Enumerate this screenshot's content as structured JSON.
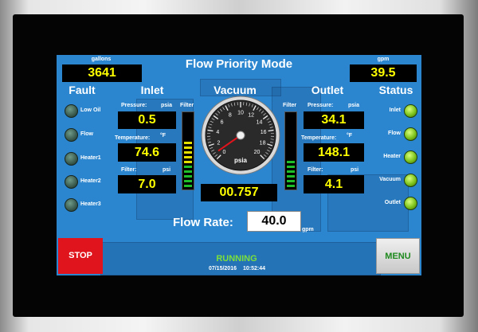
{
  "screen": {
    "title": "Flow Priority Mode",
    "left_counter": {
      "unit": "gallons",
      "value": "3641"
    },
    "right_counter": {
      "unit": "gpm",
      "value": "39.5"
    }
  },
  "fault": {
    "title": "Fault",
    "items": [
      {
        "label": "Low Oil",
        "state": "off"
      },
      {
        "label": "Flow",
        "state": "off"
      },
      {
        "label": "Heater1",
        "state": "off"
      },
      {
        "label": "Heater2",
        "state": "off"
      },
      {
        "label": "Heater3",
        "state": "off"
      }
    ]
  },
  "inlet": {
    "title": "Inlet",
    "pressure_label": "Pressure:",
    "pressure_unit": "psia",
    "pressure": "0.5",
    "temperature_label": "Temperature:",
    "temperature_unit": "°F",
    "temperature": "74.6",
    "filter_label": "Filter:",
    "filter_unit": "psi",
    "filter": "7.0",
    "bar_label": "Filter"
  },
  "vacuum": {
    "title": "Vacuum",
    "value": "00.757",
    "gauge_unit": "psia",
    "gauge_min": 0,
    "gauge_max": 20,
    "gauge_value": 0.757,
    "ticks": [
      "0",
      "2",
      "4",
      "6",
      "8",
      "10",
      "12",
      "14",
      "16",
      "18",
      "20"
    ]
  },
  "outlet": {
    "title": "Outlet",
    "pressure_label": "Pressure:",
    "pressure_unit": "psia",
    "pressure": "34.1",
    "temperature_label": "Temperature:",
    "temperature_unit": "°F",
    "temperature": "148.1",
    "filter_label": "Filter:",
    "filter_unit": "psi",
    "filter": "4.1",
    "bar_label": "Filter"
  },
  "status": {
    "title": "Status",
    "items": [
      {
        "label": "Inlet",
        "state": "on"
      },
      {
        "label": "Flow",
        "state": "on"
      },
      {
        "label": "Heater",
        "state": "on"
      },
      {
        "label": "Vacuum",
        "state": "on"
      },
      {
        "label": "Outlet",
        "state": "on"
      }
    ]
  },
  "flow_rate": {
    "label": "Flow Rate:",
    "value": "40.0",
    "unit": "gpm"
  },
  "footer": {
    "stop_label": "STOP",
    "menu_label": "MENU",
    "state": "RUNNING",
    "date": "07/15/2016",
    "time": "10:52:44"
  },
  "colors": {
    "screen_bg": "#2b86cf",
    "value_fg": "#ffff00",
    "running": "#7be03a",
    "stop_bg": "#e0141c",
    "menu_fg": "#1e8a1e"
  }
}
